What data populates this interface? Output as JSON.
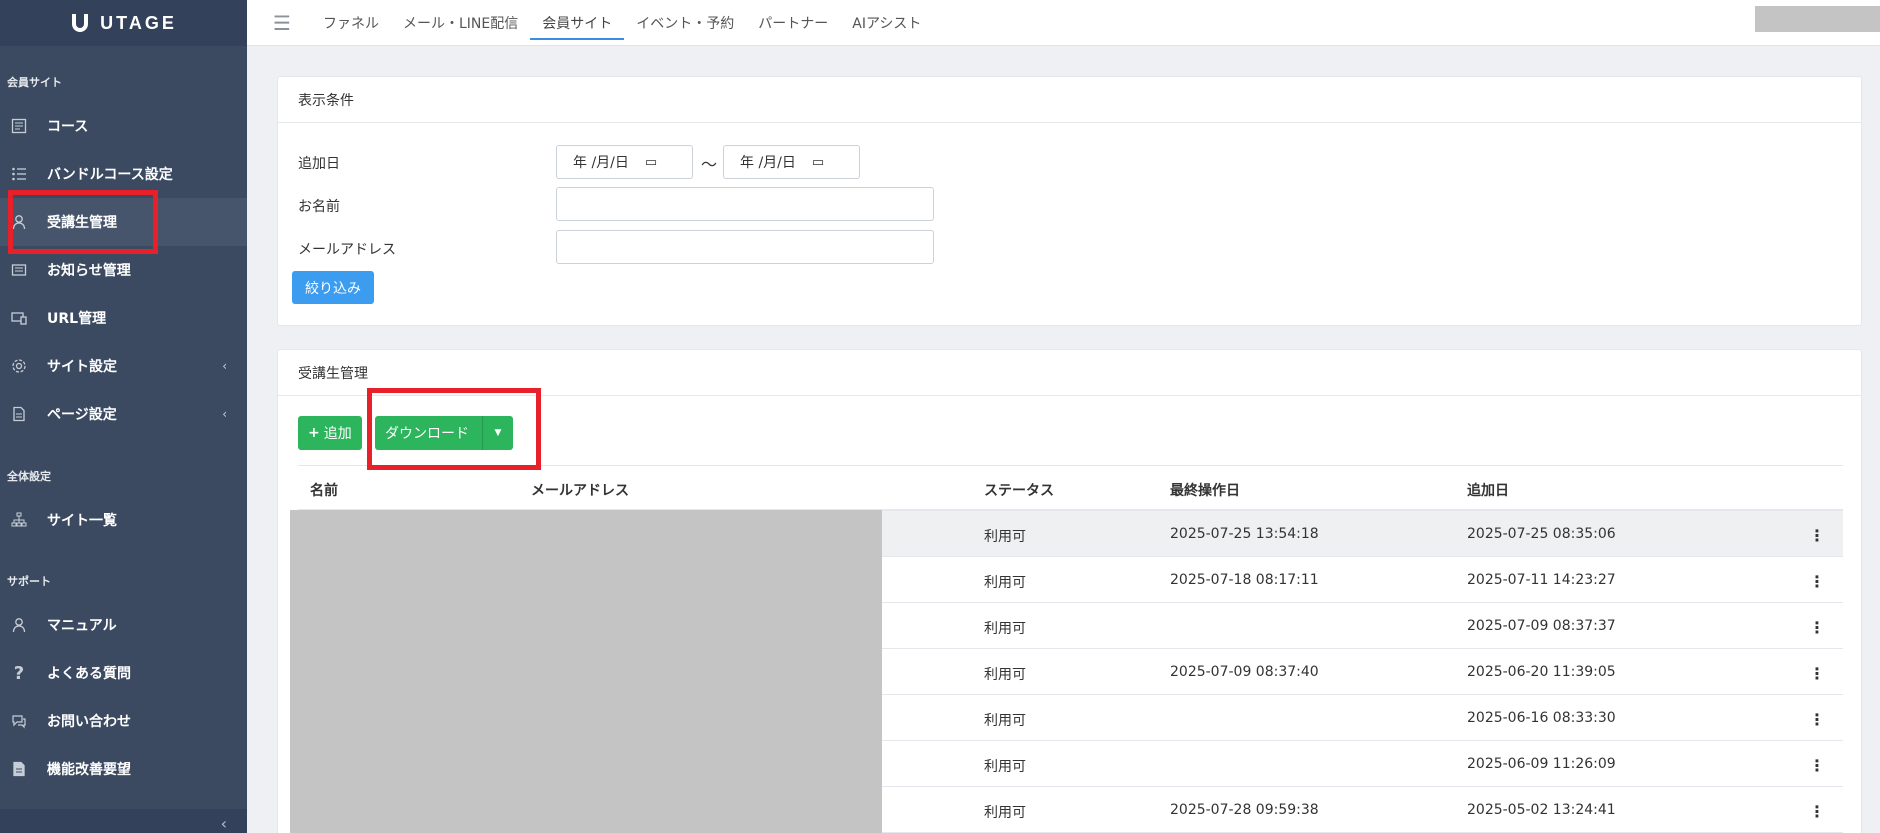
{
  "brand": {
    "name": "UTAGE"
  },
  "sidebar": {
    "sections": [
      {
        "label": "会員サイト"
      },
      {
        "label": "全体設定"
      },
      {
        "label": "サポート"
      }
    ],
    "items": [
      {
        "label": "コース",
        "icon": "document-list-icon"
      },
      {
        "label": "バンドルコース設定",
        "icon": "list-icon"
      },
      {
        "label": "受講生管理",
        "icon": "user-icon"
      },
      {
        "label": "お知らせ管理",
        "icon": "newspaper-icon"
      },
      {
        "label": "URL管理",
        "icon": "devices-icon"
      },
      {
        "label": "サイト設定",
        "icon": "gear-icon"
      },
      {
        "label": "ページ設定",
        "icon": "file-icon"
      },
      {
        "label": "サイト一覧",
        "icon": "sitemap-icon"
      },
      {
        "label": "マニュアル",
        "icon": "user-icon"
      },
      {
        "label": "よくある質問",
        "icon": "question-icon"
      },
      {
        "label": "お問い合わせ",
        "icon": "chat-icon"
      },
      {
        "label": "機能改善要望",
        "icon": "file-icon"
      }
    ]
  },
  "topnav": {
    "tabs": [
      {
        "label": "ファネル"
      },
      {
        "label": "メール・LINE配信"
      },
      {
        "label": "会員サイト"
      },
      {
        "label": "イベント・予約"
      },
      {
        "label": "パートナー"
      },
      {
        "label": "AIアシスト"
      }
    ]
  },
  "filter": {
    "title": "表示条件",
    "added_date_label": "追加日",
    "date_placeholder": "年 /月/日",
    "tilde": "〜",
    "name_label": "お名前",
    "email_label": "メールアドレス",
    "submit_label": "絞り込み"
  },
  "students": {
    "title": "受講生管理",
    "add_label": "追加",
    "download_label": "ダウンロード",
    "columns": {
      "name": "名前",
      "email": "メールアドレス",
      "status": "ステータス",
      "last_op": "最終操作日",
      "added": "追加日"
    },
    "rows": [
      {
        "status": "利用可",
        "last_op": "2025-07-25 13:54:18",
        "added": "2025-07-25 08:35:06"
      },
      {
        "status": "利用可",
        "last_op": "2025-07-18 08:17:11",
        "added": "2025-07-11 14:23:27"
      },
      {
        "status": "利用可",
        "last_op": "",
        "added": "2025-07-09 08:37:37"
      },
      {
        "status": "利用可",
        "last_op": "2025-07-09 08:37:40",
        "added": "2025-06-20 11:39:05"
      },
      {
        "status": "利用可",
        "last_op": "",
        "added": "2025-06-16 08:33:30"
      },
      {
        "status": "利用可",
        "last_op": "",
        "added": "2025-06-09 11:26:09"
      },
      {
        "status": "利用可",
        "last_op": "2025-07-28 09:59:38",
        "added": "2025-05-02 13:24:41"
      }
    ]
  },
  "colors": {
    "sidebar_bg": "#3b4a61",
    "primary_blue": "#3c9cf0",
    "success_green": "#2db55d",
    "highlight_red": "#e8202a"
  }
}
